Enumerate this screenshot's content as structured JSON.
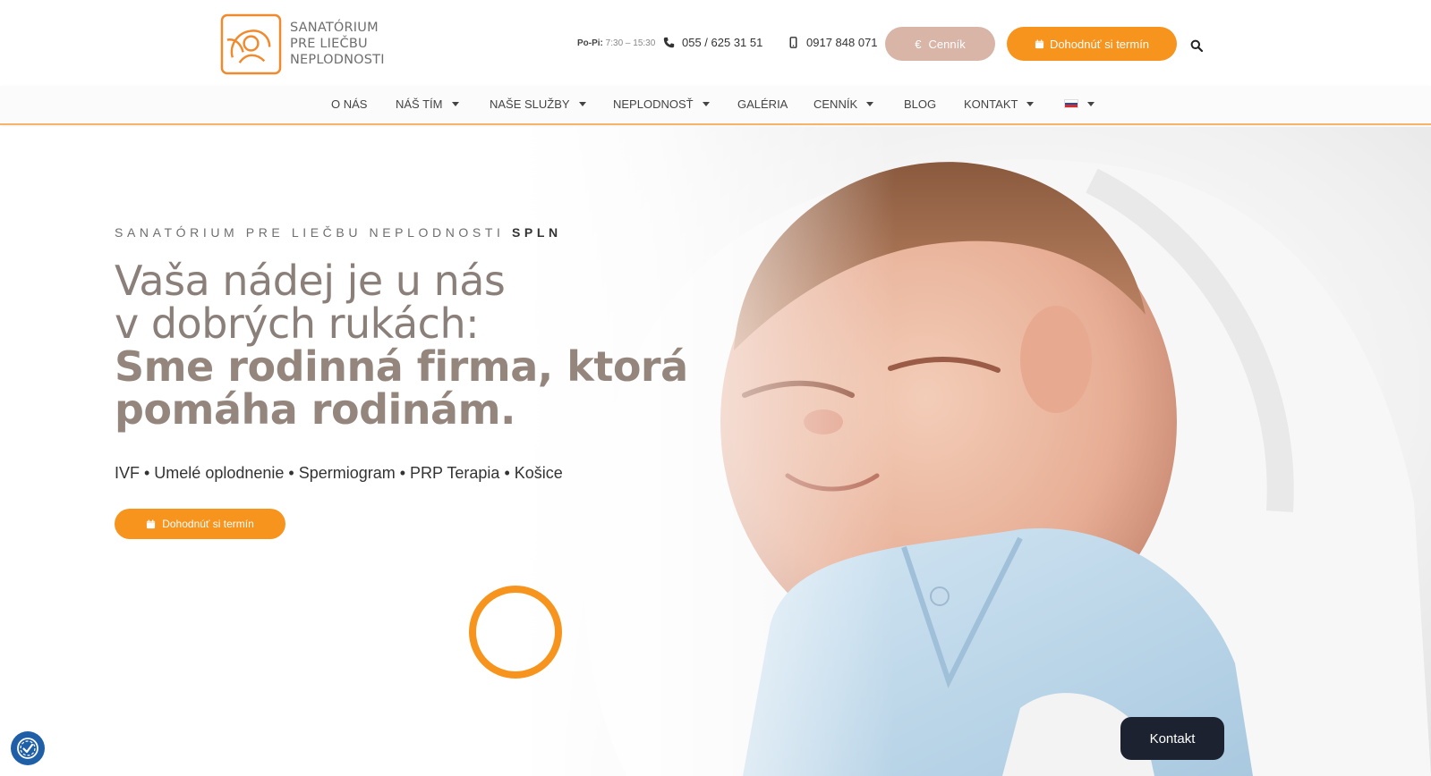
{
  "brand": {
    "logo_lines": [
      "SANATÓRIUM",
      "PRE LIEČBU",
      "NEPLODNOSTI"
    ],
    "accent": "#f7941d",
    "soft_accent": "#d8b5a7"
  },
  "topbar": {
    "hours_label": "Po-Pi:",
    "hours_value": "7:30 – 15:30",
    "phone_landline": "055 / 625 31 51",
    "phone_mobile": "0917 848 071",
    "pricing_button": "Cenník",
    "pricing_icon": "euro-icon",
    "book_button": "Dohodnúť si termín",
    "book_icon": "calendar-icon",
    "search_icon": "search-icon"
  },
  "nav": {
    "items": [
      {
        "label": "O NÁS",
        "dropdown": false
      },
      {
        "label": "NÁŠ TÍM",
        "dropdown": true
      },
      {
        "label": "NAŠE SLUŽBY",
        "dropdown": true
      },
      {
        "label": "NEPLODNOSŤ",
        "dropdown": true
      },
      {
        "label": "GALÉRIA",
        "dropdown": false
      },
      {
        "label": "CENNÍK",
        "dropdown": true
      },
      {
        "label": "BLOG",
        "dropdown": false
      },
      {
        "label": "KONTAKT",
        "dropdown": true
      }
    ],
    "language_flag": "slovak-flag-icon"
  },
  "hero": {
    "kicker": "SANATÓRIUM PRE LIEČBU NEPLODNOSTI",
    "kicker_bold": "SPLN",
    "heading_line1": "Vaša nádej je u nás",
    "heading_line2": "v dobrých rukách:",
    "heading_line3": "Sme rodinná firma, ktorá",
    "heading_line4": "pomáha rodinám.",
    "services": "IVF • Umelé oplodnenie • Spermiogram • PRP Terapia • Košice",
    "cta": "Dohodnúť si termín",
    "image": "sleeping-newborn-in-white-blanket"
  },
  "widgets": {
    "contact_button": "Kontakt",
    "accessibility_icon": "accessibility-icon"
  }
}
